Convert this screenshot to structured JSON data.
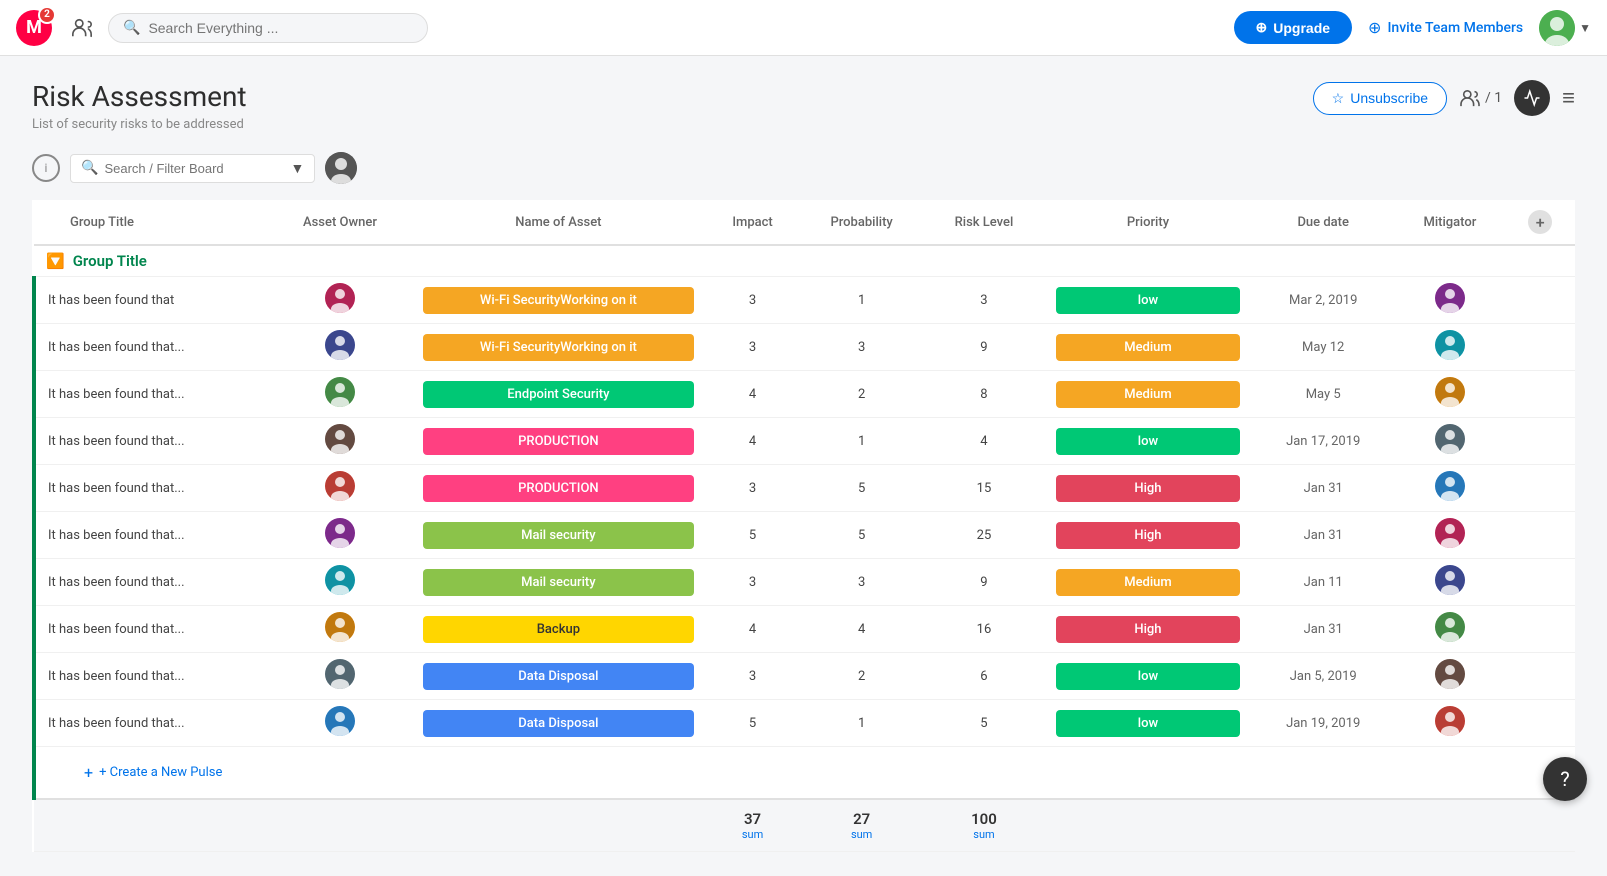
{
  "topNav": {
    "logoText": "M",
    "badgeCount": "2",
    "searchPlaceholder": "Search Everything ...",
    "upgradeLabel": "Upgrade",
    "inviteLabel": "Invite Team Members",
    "chevron": "▼"
  },
  "page": {
    "title": "Risk Assessment",
    "subtitle": "List of security risks to be addressed",
    "unsubscribeLabel": "Unsubscribe",
    "membersCount": "/ 1",
    "menuIcon": "≡"
  },
  "toolbar": {
    "filterPlaceholder": "Search / Filter Board"
  },
  "table": {
    "columns": [
      "Group Title",
      "Asset Owner",
      "Name of Asset",
      "Impact",
      "Probability",
      "Risk Level",
      "Priority",
      "Due date",
      "Mitigator"
    ],
    "groupTitle": "Group Title",
    "addIcon": "+",
    "createPulse": "+ Create a New Pulse",
    "rows": [
      {
        "label": "It has been found that",
        "asset": "Wi-Fi SecurityWorking on it",
        "assetClass": "asset-orange",
        "impact": 3,
        "probability": 1,
        "riskLevel": 3,
        "priority": "low",
        "priorityClass": "priority-low",
        "dueDate": "Mar 2, 2019",
        "ownerAv": "av1",
        "mitigatorAv": "av2"
      },
      {
        "label": "It has been found that...",
        "asset": "Wi-Fi SecurityWorking on it",
        "assetClass": "asset-orange",
        "impact": 3,
        "probability": 3,
        "riskLevel": 9,
        "priority": "Medium",
        "priorityClass": "priority-medium",
        "dueDate": "May 12",
        "ownerAv": "av3",
        "mitigatorAv": "av4"
      },
      {
        "label": "It has been found that...",
        "asset": "Endpoint Security",
        "assetClass": "asset-green",
        "impact": 4,
        "probability": 2,
        "riskLevel": 8,
        "priority": "Medium",
        "priorityClass": "priority-medium",
        "dueDate": "May 5",
        "ownerAv": "av5",
        "mitigatorAv": "av6"
      },
      {
        "label": "It has been found that...",
        "asset": "PRODUCTION",
        "assetClass": "asset-pink",
        "impact": 4,
        "probability": 1,
        "riskLevel": 4,
        "priority": "low",
        "priorityClass": "priority-low",
        "dueDate": "Jan 17, 2019",
        "ownerAv": "av7",
        "mitigatorAv": "av8"
      },
      {
        "label": "It has been found that...",
        "asset": "PRODUCTION",
        "assetClass": "asset-pink",
        "impact": 3,
        "probability": 5,
        "riskLevel": 15,
        "priority": "High",
        "priorityClass": "priority-high",
        "dueDate": "Jan 31",
        "ownerAv": "av9",
        "mitigatorAv": "av10"
      },
      {
        "label": "It has been found that...",
        "asset": "Mail security",
        "assetClass": "asset-lime",
        "impact": 5,
        "probability": 5,
        "riskLevel": 25,
        "priority": "High",
        "priorityClass": "priority-high",
        "dueDate": "Jan 31",
        "ownerAv": "av2",
        "mitigatorAv": "av1"
      },
      {
        "label": "It has been found that...",
        "asset": "Mail security",
        "assetClass": "asset-lime",
        "impact": 3,
        "probability": 3,
        "riskLevel": 9,
        "priority": "Medium",
        "priorityClass": "priority-medium",
        "dueDate": "Jan 11",
        "ownerAv": "av4",
        "mitigatorAv": "av3"
      },
      {
        "label": "It has been found that...",
        "asset": "Backup",
        "assetClass": "asset-yellow",
        "impact": 4,
        "probability": 4,
        "riskLevel": 16,
        "priority": "High",
        "priorityClass": "priority-high",
        "dueDate": "Jan 31",
        "ownerAv": "av6",
        "mitigatorAv": "av5"
      },
      {
        "label": "It has been found that...",
        "asset": "Data Disposal",
        "assetClass": "asset-blue",
        "impact": 3,
        "probability": 2,
        "riskLevel": 6,
        "priority": "low",
        "priorityClass": "priority-low",
        "dueDate": "Jan 5, 2019",
        "ownerAv": "av8",
        "mitigatorAv": "av7"
      },
      {
        "label": "It has been found that...",
        "asset": "Data Disposal",
        "assetClass": "asset-blue",
        "impact": 5,
        "probability": 1,
        "riskLevel": 5,
        "priority": "low",
        "priorityClass": "priority-low",
        "dueDate": "Jan 19, 2019",
        "ownerAv": "av10",
        "mitigatorAv": "av9"
      }
    ],
    "sums": {
      "impact": {
        "value": "37",
        "label": "sum"
      },
      "probability": {
        "value": "27",
        "label": "sum"
      },
      "riskLevel": {
        "value": "100",
        "label": "sum"
      }
    }
  },
  "help": "?"
}
